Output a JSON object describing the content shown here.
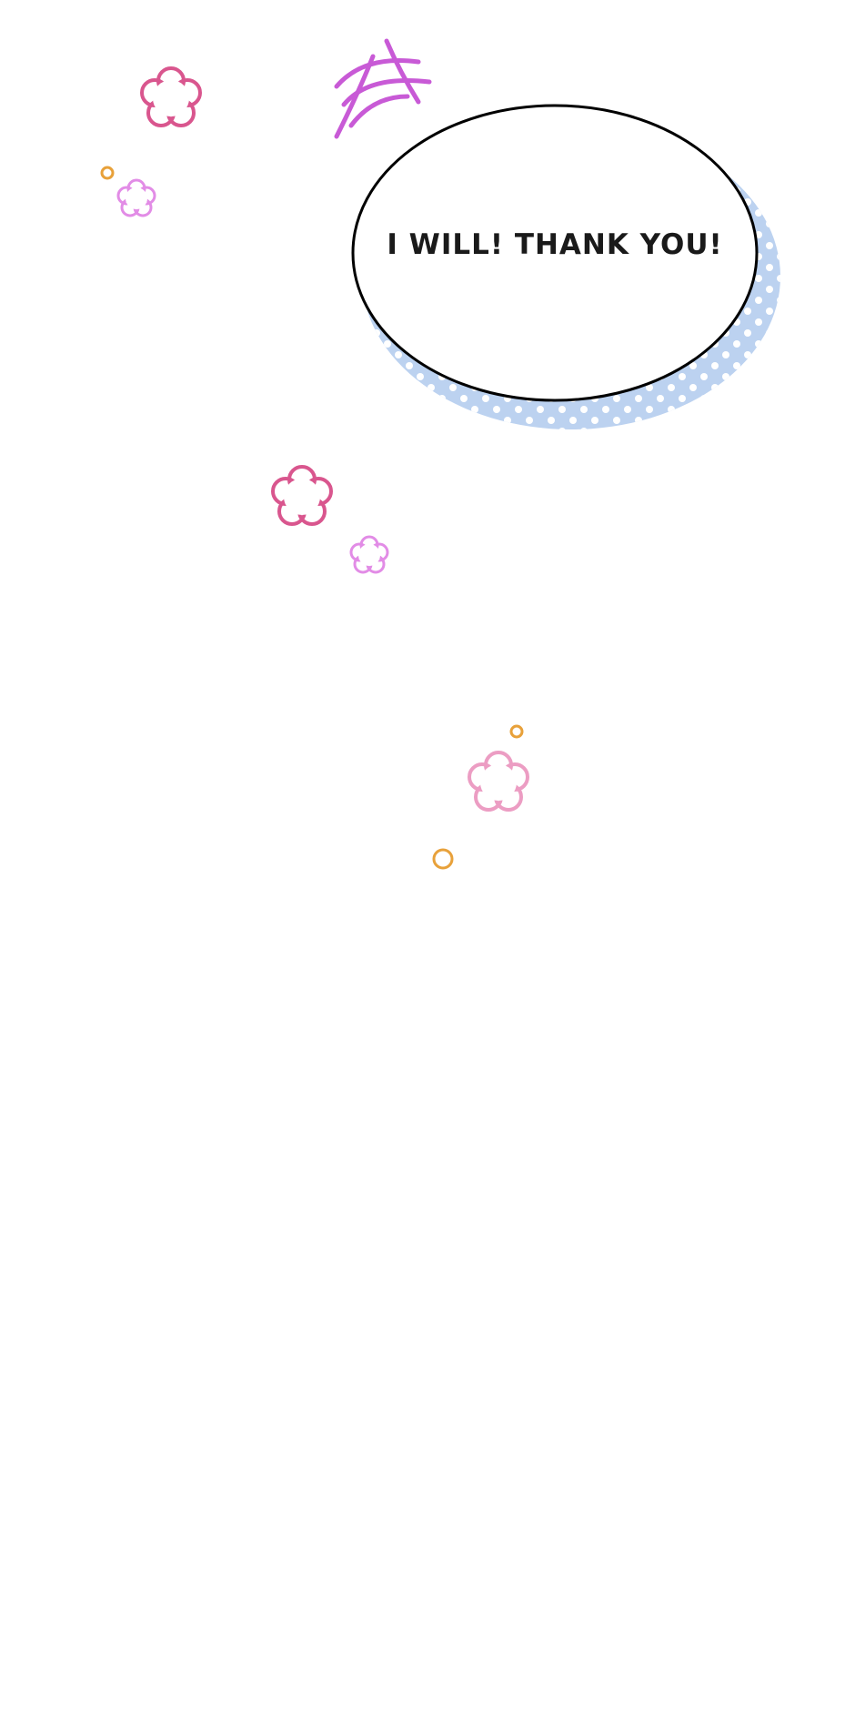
{
  "speech_bubble": {
    "text": "I WILL! THANK YOU!",
    "fill_color": "#ffffff",
    "outline_color": "#000000",
    "shadow_color": "#bcd2f0",
    "dot_color": "#ffffff"
  },
  "decorations": {
    "flower_icon": "flower-outline-icon",
    "sparkle_icon": "crosshatch-sparkle-icon",
    "circle_icon": "small-circle-icon",
    "colors": {
      "magenta_flower": "#d9568e",
      "violet_flower": "#e28ce6",
      "pink_flower": "#ec9dc3",
      "sparkle": "#c85ad6",
      "orange_circle": "#e8a13a"
    }
  }
}
